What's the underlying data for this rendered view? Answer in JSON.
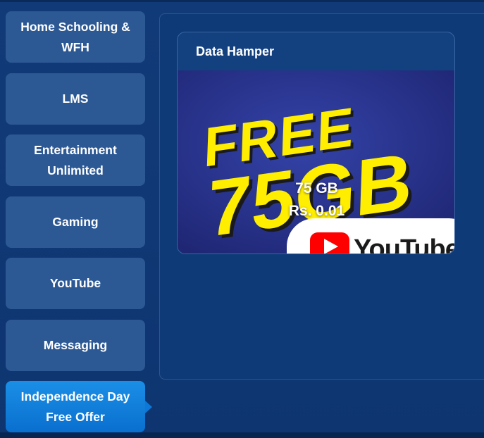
{
  "sidebar": {
    "items": [
      {
        "label": "Home Schooling & WFH",
        "active": false
      },
      {
        "label": "LMS",
        "active": false
      },
      {
        "label": "Entertainment Unlimited",
        "active": false
      },
      {
        "label": "Gaming",
        "active": false
      },
      {
        "label": "YouTube",
        "active": false
      },
      {
        "label": "Messaging",
        "active": false
      },
      {
        "label": "Independence Day Free Offer",
        "active": true
      }
    ]
  },
  "card": {
    "title": "Data Hamper",
    "data_amount": "75 GB",
    "price": "Rs. 0.01",
    "banner": {
      "headline": "FREE",
      "amount": "75GB",
      "brand": "YouTube",
      "colors": {
        "background": "#2a3590",
        "headline": "#ffee00",
        "brand_red": "#ff0000"
      }
    }
  },
  "colors": {
    "page_background": "#0e3670",
    "sidebar_item": "#2c5894",
    "sidebar_active": "#0d78d8"
  }
}
